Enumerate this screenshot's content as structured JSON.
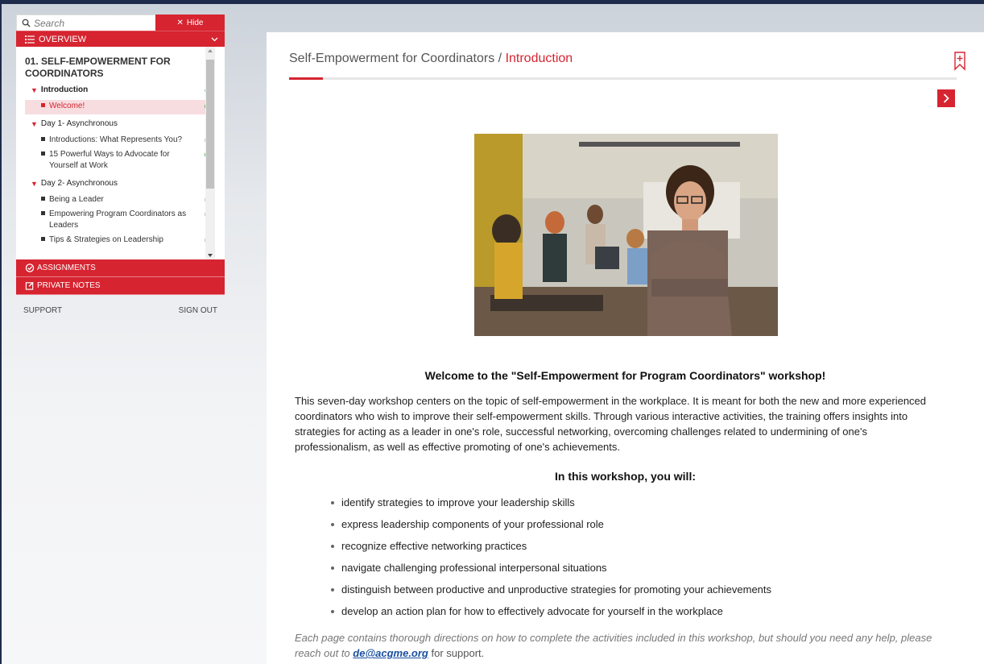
{
  "sidebar": {
    "search_placeholder": "Search",
    "hide_label": "Hide",
    "overview_label": "OVERVIEW",
    "course_title": "01. SELF-EMPOWERMENT FOR COORDINATORS",
    "sections": [
      {
        "label": "Introduction",
        "complete": true,
        "items": [
          {
            "label": "Welcome!",
            "status": "done",
            "active": true
          }
        ]
      },
      {
        "label": "Day 1- Asynchronous",
        "items": [
          {
            "label": "Introductions: What Represents You?",
            "status": "todo"
          },
          {
            "label": "15 Powerful Ways to Advocate for Yourself at Work",
            "status": "done"
          }
        ]
      },
      {
        "label": "Day 2- Asynchronous",
        "items": [
          {
            "label": "Being a Leader",
            "status": "todo"
          },
          {
            "label": "Empowering Program Coordinators as Leaders",
            "status": "todo"
          },
          {
            "label": "Tips & Strategies on Leadership",
            "status": "todo"
          }
        ]
      }
    ],
    "assignments_label": "ASSIGNMENTS",
    "private_notes_label": "PRIVATE NOTES",
    "support_label": "SUPPORT",
    "sign_out_label": "SIGN OUT"
  },
  "main": {
    "breadcrumb_course": "Self-Empowerment for Coordinators",
    "breadcrumb_separator": " / ",
    "breadcrumb_current": "Introduction",
    "welcome_heading": "Welcome to the \"Self-Empowerment for Program Coordinators\" workshop!",
    "intro_text": "This seven-day workshop centers on the topic of self-empowerment in the workplace. It is meant for both the new and more experienced coordinators who wish to improve their self-empowerment skills. Through various interactive activities, the training offers insights into strategies for acting as a leader in one's role, successful networking, overcoming challenges related to undermining of one's professionalism, as well as effective promoting of one's achievements.",
    "goals_heading": "In this workshop, you will:",
    "goals": [
      "identify strategies to improve your leadership skills",
      "express leadership components of your professional role",
      "recognize effective networking practices",
      "navigate challenging professional interpersonal situations",
      "distinguish between productive and unproductive strategies for promoting your achievements",
      "develop an action plan for how to effectively advocate for yourself in the workplace"
    ],
    "help_text_before": "Each page contains thorough directions on how to complete the activities included in this workshop, but should you need any help, please reach out to ",
    "help_email": "de@acgme.org",
    "help_text_after": " for support."
  },
  "colors": {
    "accent": "#d62430",
    "complete": "#3fb34f"
  }
}
